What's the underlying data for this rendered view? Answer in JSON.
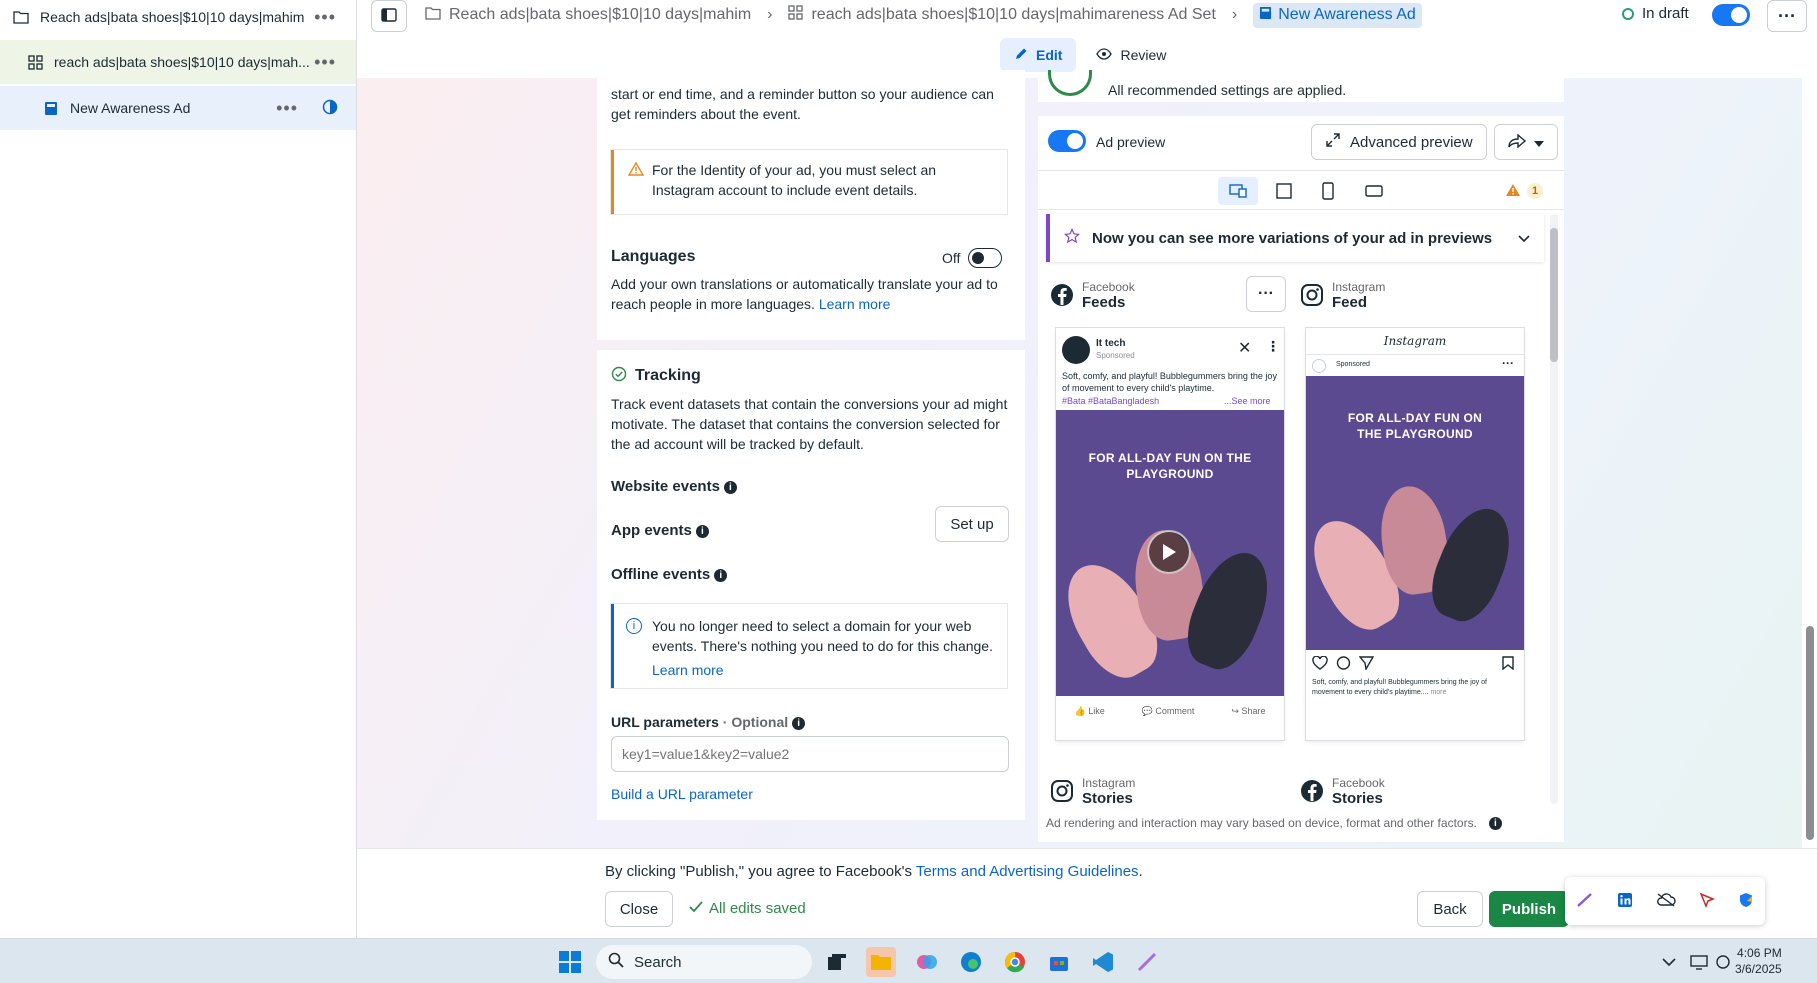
{
  "sidebar": {
    "campaign": "Reach ads|bata shoes|$10|10 days|mahim",
    "adset": "reach ads|bata shoes|$10|10 days|mah...",
    "ad": "New Awareness Ad"
  },
  "header": {
    "crumb_campaign": "Reach ads|bata shoes|$10|10 days|mahim",
    "crumb_adset": "reach ads|bata shoes|$10|10 days|mahimareness Ad Set",
    "crumb_ad": "New Awareness Ad",
    "status": "In draft",
    "mode_edit": "Edit",
    "mode_review": "Review"
  },
  "events_card": {
    "body": "start or end time, and a reminder button so your audience can get reminders about the event.",
    "warning": "For the Identity of your ad, you must select an Instagram account to include event details."
  },
  "languages": {
    "title": "Languages",
    "toggle_label": "Off",
    "body": "Add your own translations or automatically translate your ad to reach people in more languages.",
    "link": "Learn more"
  },
  "tracking": {
    "title": "Tracking",
    "body": "Track event datasets that contain the conversions your ad might motivate. The dataset that contains the conversion selected for the ad account will be tracked by default.",
    "website_events": "Website events",
    "app_events": "App events",
    "offline_events": "Offline events",
    "setup_label": "Set up",
    "info": "You no longer need to select a domain for your web events. There's nothing you need to do for this change.",
    "info_link": "Learn more",
    "url_label": "URL parameters",
    "url_optional": "· Optional",
    "url_placeholder": "key1=value1&key2=value2",
    "build_link": "Build a URL parameter"
  },
  "preview": {
    "recommended": "All recommended settings are applied.",
    "ad_preview_label": "Ad preview",
    "advanced_label": "Advanced preview",
    "warning_count": "1",
    "banner": "Now you can see more variations of your ad in previews",
    "fb_feeds_platform": "Facebook",
    "fb_feeds_name": "Feeds",
    "ig_feed_platform": "Instagram",
    "ig_feed_name": "Feed",
    "ig_stories_platform": "Instagram",
    "ig_stories_name": "Stories",
    "fb_stories_platform": "Facebook",
    "fb_stories_name": "Stories",
    "page_name": "It tech",
    "sponsored": "Sponsored",
    "ad_text": "Soft, comfy, and playful! Bubblegummers bring the joy of movement to every child's playtime.",
    "hashtags": "#Bata #BataBangladesh",
    "see_more": "...See more",
    "creative_headline": "FOR ALL-DAY FUN ON THE PLAYGROUND",
    "like": "Like",
    "comment": "Comment",
    "share": "Share",
    "ig_logo": "Instagram",
    "ig_caption": "Soft, comfy, and playful! Bubblegummers bring the joy of movement to every child's playtime....",
    "ig_more": "more",
    "footnote": "Ad rendering and interaction may vary based on device, format and other factors."
  },
  "bottom": {
    "consent_prefix": "By clicking \"Publish,\" you agree to Facebook's",
    "consent_link": "Terms and Advertising Guidelines",
    "consent_suffix": ".",
    "close": "Close",
    "saved": "All edits saved",
    "back": "Back",
    "publish": "Publish"
  },
  "taskbar": {
    "search": "Search",
    "time": "4:06 PM",
    "date": "3/6/2025"
  },
  "colors": {
    "accent": "#0a66c2",
    "publish": "#1a8744",
    "warning": "#e8871e",
    "creative_bg": "#5b4a8f"
  }
}
